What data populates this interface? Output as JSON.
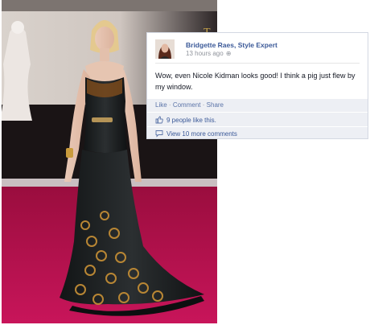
{
  "post": {
    "author": "Bridgette Raes, Style Expert",
    "timestamp": "13 hours ago",
    "privacy_icon": "globe-icon",
    "text": "Wow, even Nicole Kidman looks good! I think a pig just flew by my window.",
    "actions": {
      "like": "Like",
      "comment": "Comment",
      "share": "Share",
      "separator": "·"
    },
    "likes_text": "9 people like this.",
    "more_comments_text": "View 10 more comments"
  },
  "colors": {
    "link_blue": "#3b5998",
    "carpet": "#b8124d",
    "footer_bg": "#edeff4"
  }
}
